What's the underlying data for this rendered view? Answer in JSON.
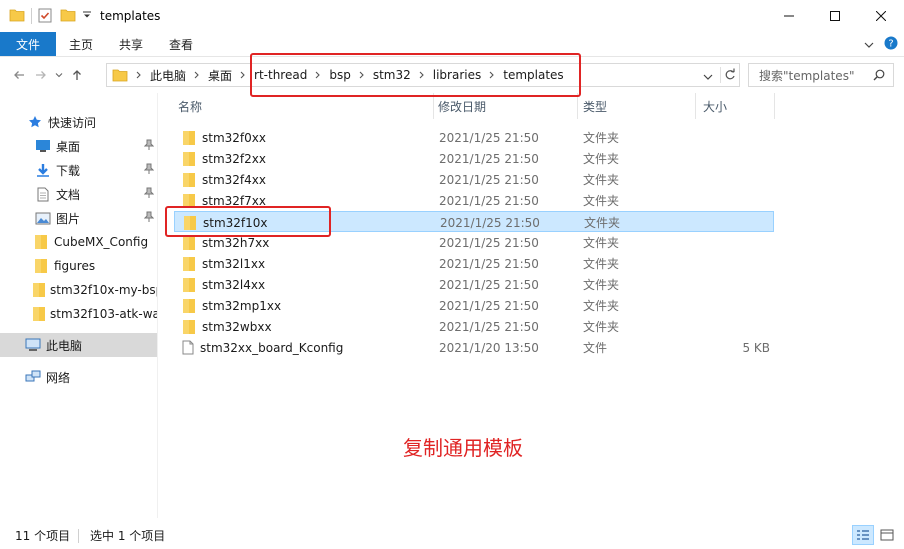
{
  "window": {
    "title": "templates"
  },
  "ribbon": {
    "tabs": [
      "文件",
      "主页",
      "共享",
      "查看"
    ]
  },
  "address": {
    "crumbs": [
      "此电脑",
      "桌面",
      "rt-thread",
      "bsp",
      "stm32",
      "libraries",
      "templates"
    ]
  },
  "search": {
    "placeholder": "搜索\"templates\""
  },
  "nav": {
    "quick_access": "快速访问",
    "items": [
      {
        "label": "桌面",
        "icon": "desktop-icon",
        "pinned": true
      },
      {
        "label": "下载",
        "icon": "download-icon",
        "pinned": true
      },
      {
        "label": "文档",
        "icon": "document-icon",
        "pinned": true
      },
      {
        "label": "图片",
        "icon": "picture-icon",
        "pinned": true
      },
      {
        "label": "CubeMX_Config",
        "icon": "folder-icon",
        "pinned": false
      },
      {
        "label": "figures",
        "icon": "folder-icon",
        "pinned": false
      },
      {
        "label": "stm32f10x-my-bsp",
        "icon": "folder-icon",
        "pinned": false
      },
      {
        "label": "stm32f103-atk-wa",
        "icon": "folder-icon",
        "pinned": false
      }
    ],
    "this_pc": "此电脑",
    "network": "网络"
  },
  "columns": {
    "name": "名称",
    "date": "修改日期",
    "type": "类型",
    "size": "大小"
  },
  "files": [
    {
      "name": "stm32f0xx",
      "date": "2021/1/25 21:50",
      "type": "文件夹",
      "size": "",
      "kind": "folder"
    },
    {
      "name": "stm32f2xx",
      "date": "2021/1/25 21:50",
      "type": "文件夹",
      "size": "",
      "kind": "folder"
    },
    {
      "name": "stm32f4xx",
      "date": "2021/1/25 21:50",
      "type": "文件夹",
      "size": "",
      "kind": "folder"
    },
    {
      "name": "stm32f7xx",
      "date": "2021/1/25 21:50",
      "type": "文件夹",
      "size": "",
      "kind": "folder"
    },
    {
      "name": "stm32f10x",
      "date": "2021/1/25 21:50",
      "type": "文件夹",
      "size": "",
      "kind": "folder",
      "selected": true
    },
    {
      "name": "stm32h7xx",
      "date": "2021/1/25 21:50",
      "type": "文件夹",
      "size": "",
      "kind": "folder"
    },
    {
      "name": "stm32l1xx",
      "date": "2021/1/25 21:50",
      "type": "文件夹",
      "size": "",
      "kind": "folder"
    },
    {
      "name": "stm32l4xx",
      "date": "2021/1/25 21:50",
      "type": "文件夹",
      "size": "",
      "kind": "folder"
    },
    {
      "name": "stm32mp1xx",
      "date": "2021/1/25 21:50",
      "type": "文件夹",
      "size": "",
      "kind": "folder"
    },
    {
      "name": "stm32wbxx",
      "date": "2021/1/25 21:50",
      "type": "文件夹",
      "size": "",
      "kind": "folder"
    },
    {
      "name": "stm32xx_board_Kconfig",
      "date": "2021/1/20 13:50",
      "type": "文件",
      "size": "5 KB",
      "kind": "file"
    }
  ],
  "annotation": {
    "note": "复制通用模板",
    "color": "#e02424"
  },
  "status": {
    "count": "11 个项目",
    "selection": "选中 1 个项目"
  },
  "colors": {
    "accent": "#1979ca",
    "folder": "#f7c948",
    "selection": "#cce8ff"
  }
}
